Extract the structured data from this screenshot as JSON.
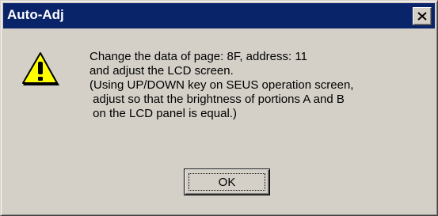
{
  "window": {
    "title": "Auto-Adj",
    "close_icon": "close-x",
    "titlebar_color": "#0a246a",
    "face_color": "#d4d0c8"
  },
  "icon": {
    "name": "warning-icon",
    "fill_color": "#ffff00"
  },
  "message": {
    "lines": [
      "Change the data of page: 8F, address: 11",
      "and adjust the LCD screen.",
      "(Using UP/DOWN key on SEUS operation screen,",
      " adjust so that the brightness of portions A and B",
      " on the LCD panel is equal.)"
    ]
  },
  "buttons": {
    "ok_label": "OK"
  }
}
